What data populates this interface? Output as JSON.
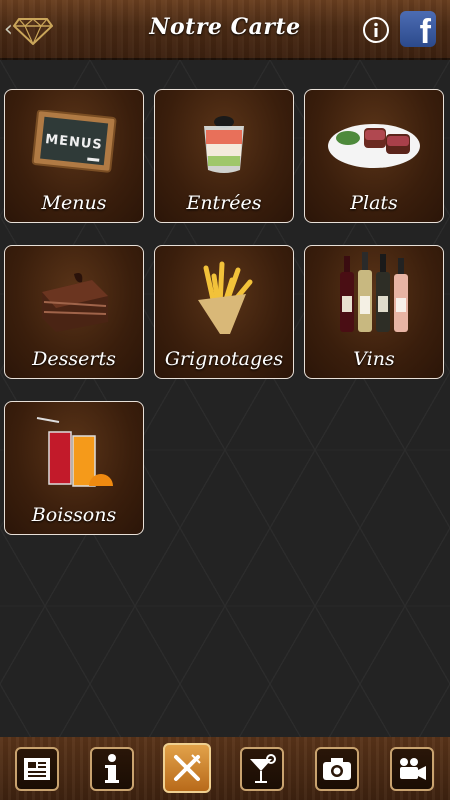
{
  "header": {
    "title": "Notre Carte",
    "back_icon": "diamond-back-icon",
    "info_icon": "info-circle-icon",
    "facebook_label": "f"
  },
  "menu": {
    "items": [
      {
        "label": "Menus",
        "icon": "chalkboard-icon"
      },
      {
        "label": "Entrées",
        "icon": "verrine-icon"
      },
      {
        "label": "Plats",
        "icon": "meat-plate-icon"
      },
      {
        "label": "Desserts",
        "icon": "chocolate-cake-icon"
      },
      {
        "label": "Grignotages",
        "icon": "fries-icon"
      },
      {
        "label": "Vins",
        "icon": "wine-bottles-icon"
      },
      {
        "label": "Boissons",
        "icon": "juice-glasses-icon"
      }
    ],
    "chalkboard_text": "MENUS"
  },
  "tabbar": {
    "tabs": [
      {
        "icon": "news-icon",
        "active": false
      },
      {
        "icon": "info-icon",
        "active": false
      },
      {
        "icon": "fork-knife-icon",
        "active": true
      },
      {
        "icon": "cocktail-icon",
        "active": false
      },
      {
        "icon": "camera-icon",
        "active": false
      },
      {
        "icon": "video-camera-icon",
        "active": false
      }
    ]
  },
  "colors": {
    "accent_active": "#e2a24a",
    "tile_border": "#e8e0d8",
    "header_wood": "#4a2a14"
  }
}
